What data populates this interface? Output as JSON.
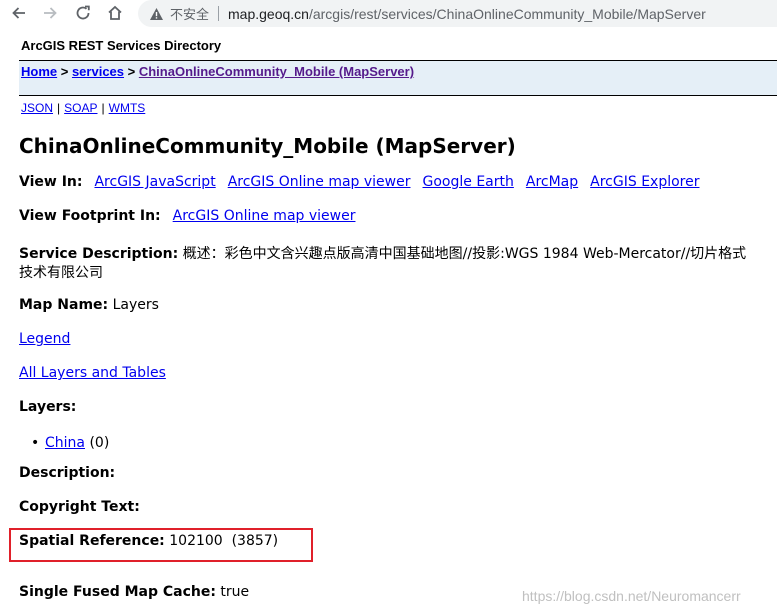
{
  "browser": {
    "insecure_label": "不安全",
    "url_host": "map.geoq.cn",
    "url_path": "/arcgis/rest/services/ChinaOnlineCommunity_Mobile/MapServer"
  },
  "page": {
    "directory_title": "ArcGIS REST Services Directory",
    "breadcrumb": {
      "home": "Home",
      "sep1": " > ",
      "services": "services",
      "sep2": " > ",
      "current": "ChinaOnlineCommunity_Mobile (MapServer)"
    },
    "formats": [
      "JSON",
      "SOAP",
      "WMTS"
    ],
    "format_separator": "|",
    "heading": "ChinaOnlineCommunity_Mobile (MapServer)",
    "view_in": {
      "label": "View In:",
      "links": [
        "ArcGIS JavaScript",
        "ArcGIS Online map viewer",
        "Google Earth",
        "ArcMap",
        "ArcGIS Explorer"
      ]
    },
    "view_footprint": {
      "label": "View Footprint In:",
      "link": "ArcGIS Online map viewer"
    },
    "service_description": {
      "label": "Service Description:",
      "line1": "概述：彩色中文含兴趣点版高清中国基础地图//投影:WGS 1984 Web-Mercator//切片格式",
      "line2": "技术有限公司"
    },
    "map_name": {
      "label": "Map Name:",
      "value": "Layers"
    },
    "legend_link": "Legend",
    "all_layers_link": "All Layers and Tables",
    "layers": {
      "label": "Layers:",
      "items": [
        {
          "name": "China",
          "id": "(0)"
        }
      ]
    },
    "description": {
      "label": "Description:"
    },
    "copyright": {
      "label": "Copyright Text:"
    },
    "spatial_reference": {
      "label": "Spatial Reference:",
      "value": "102100  (3857)"
    },
    "single_fused": {
      "label": "Single Fused Map Cache:",
      "value": "true"
    },
    "watermark": "https://blog.csdn.net/Neuromancerr"
  },
  "colors": {
    "link": "#0000ee",
    "visited": "#551a8b",
    "breadcrumb_bg": "#e5eff7",
    "highlight": "#e0202a"
  }
}
